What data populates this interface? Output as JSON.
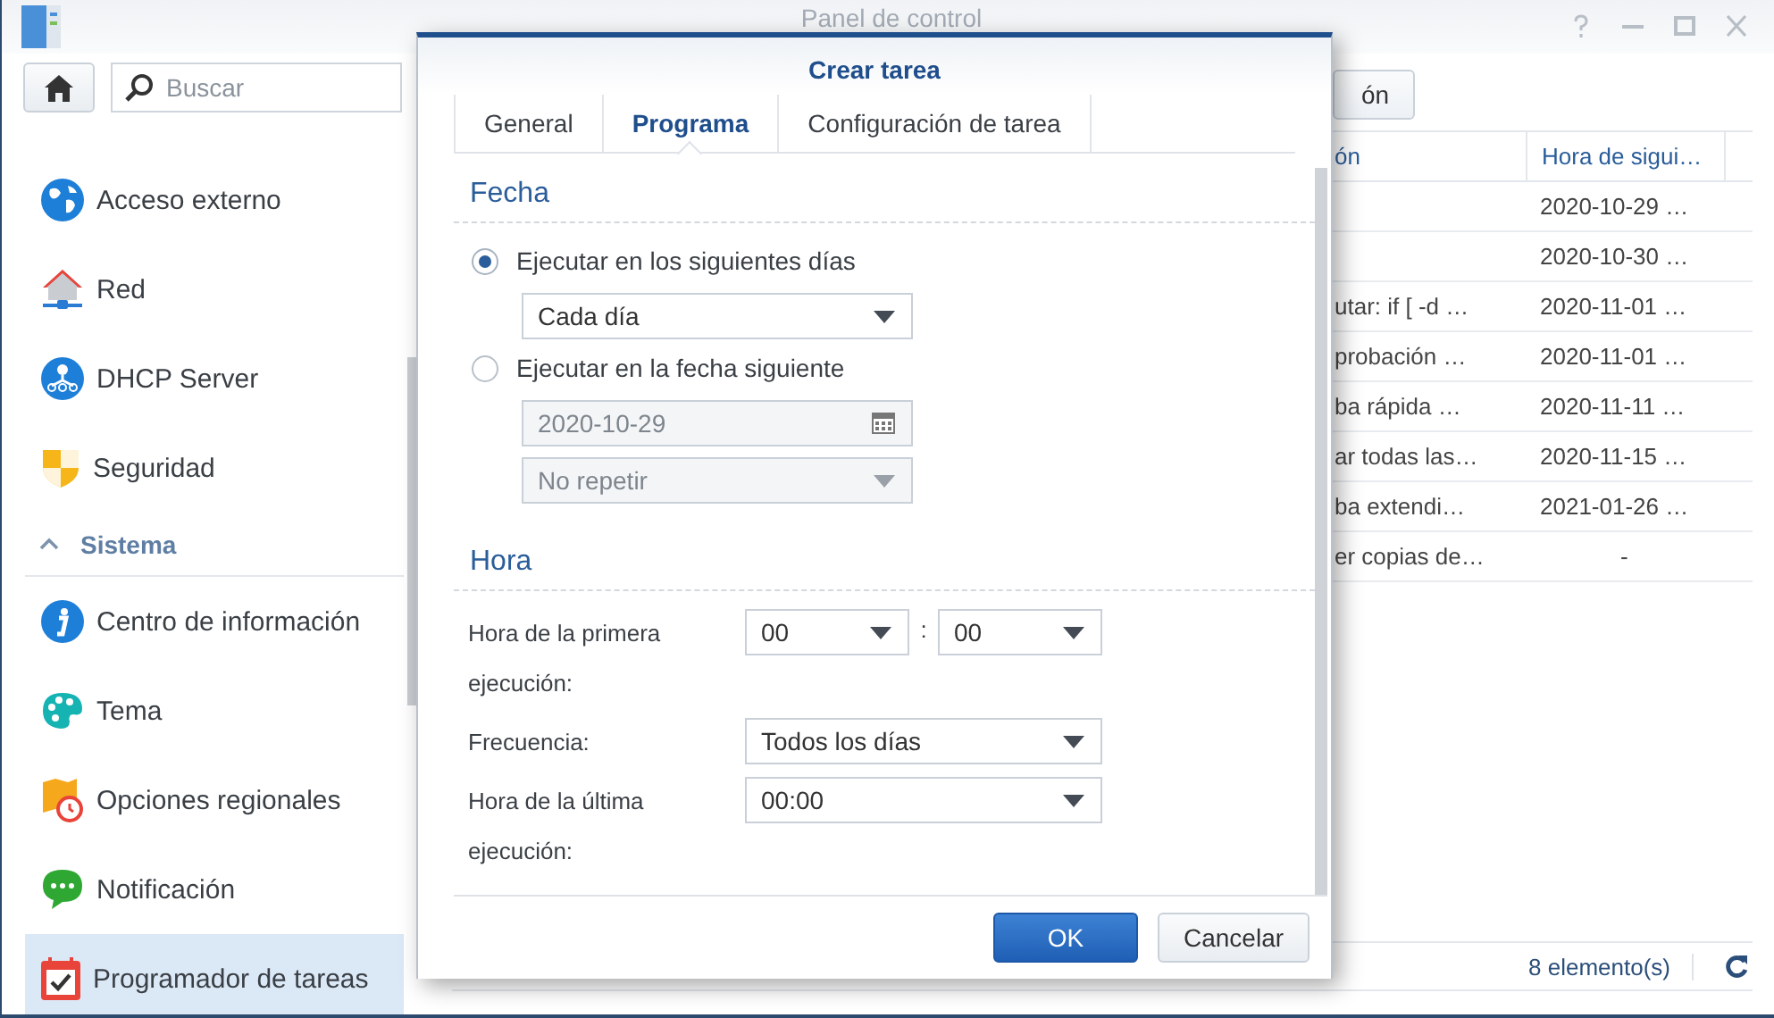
{
  "window": {
    "title": "Panel de control"
  },
  "sidebar": {
    "search": {
      "placeholder": "Buscar"
    },
    "items": [
      {
        "kind": "item",
        "label": "Acceso externo",
        "selected": false
      },
      {
        "kind": "item",
        "label": "Red",
        "selected": false
      },
      {
        "kind": "item",
        "label": "DHCP Server",
        "selected": false
      },
      {
        "kind": "item",
        "label": "Seguridad",
        "selected": false
      },
      {
        "kind": "header",
        "label": "Sistema",
        "expanded": true
      },
      {
        "kind": "item",
        "label": "Centro de información",
        "selected": false
      },
      {
        "kind": "item",
        "label": "Tema",
        "selected": false
      },
      {
        "kind": "item",
        "label": "Opciones regionales",
        "selected": false
      },
      {
        "kind": "item",
        "label": "Notificación",
        "selected": false
      },
      {
        "kind": "item",
        "label": "Programador de tareas",
        "selected": true
      }
    ]
  },
  "toolbar": {
    "button": "ón"
  },
  "table": {
    "columns": [
      "ón",
      "Hora de sigui…"
    ],
    "rows": [
      {
        "column_2": "2020-10-29 …"
      },
      {
        "column_2": "2020-10-30 …"
      },
      {
        "column_1": "utar: if [ -d …",
        "column_2": "2020-11-01 …"
      },
      {
        "column_1": "probación …",
        "column_2": "2020-11-01 …"
      },
      {
        "column_1": "ba rápida …",
        "column_2": "2020-11-11 …"
      },
      {
        "column_1": "ar todas las…",
        "column_2": "2020-11-15 …"
      },
      {
        "column_1": "ba extendi…",
        "column_2": "2021-01-26 …"
      },
      {
        "column_1": "er copias de…",
        "column_2": "-"
      }
    ]
  },
  "status_bar": {
    "count": "8 elemento(s)"
  },
  "dialog": {
    "title": "Crear tarea",
    "tabs": [
      {
        "label": "General",
        "selected": false
      },
      {
        "label": "Programa",
        "selected": true
      },
      {
        "label": "Configuración de tarea",
        "selected": false
      }
    ],
    "date_section": {
      "title": "Fecha",
      "options": [
        {
          "label": "Ejecutar en los siguientes días",
          "selected": true,
          "fields": [
            {
              "kind": "select",
              "value": "Cada día",
              "disabled": false
            }
          ]
        },
        {
          "label": "Ejecutar en la fecha siguiente",
          "selected": false,
          "fields": [
            {
              "kind": "date",
              "value": "2020-10-29",
              "disabled": true
            },
            {
              "kind": "select",
              "value": "No repetir",
              "disabled": true
            }
          ]
        }
      ]
    },
    "time_section": {
      "title": "Hora",
      "rows": [
        {
          "label": "Hora de la primera ejecución:",
          "separator": ":",
          "fields": [
            {
              "value": "00"
            },
            {
              "value": "00"
            }
          ]
        },
        {
          "label": "Frecuencia:",
          "fields": [
            {
              "value": "Todos los días"
            }
          ]
        },
        {
          "label": "Hora de la última ejecución:",
          "fields": [
            {
              "value": "00:00"
            }
          ]
        }
      ]
    },
    "buttons": [
      {
        "label": "OK",
        "kind": "primary"
      },
      {
        "label": "Cancelar",
        "kind": "secondary"
      }
    ]
  }
}
